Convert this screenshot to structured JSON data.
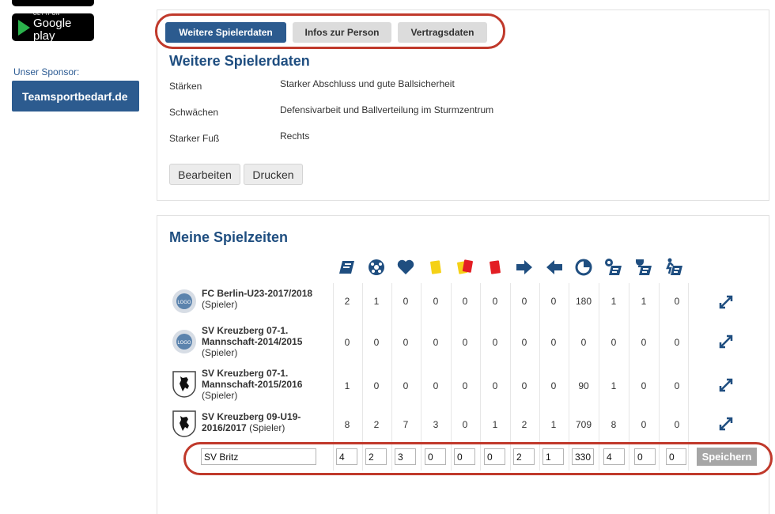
{
  "sidebar": {
    "badge_small": "GET IT ON",
    "badge_big": "Google play",
    "sponsor_label": "Unser Sponsor:",
    "sponsor_name": "Teamsportbedarf.de"
  },
  "tabs": [
    "Weitere Spielerdaten",
    "Infos zur Person",
    "Vertragsdaten"
  ],
  "details": {
    "title": "Weitere Spielerdaten",
    "rows": [
      {
        "label": "Stärken",
        "value": "Starker Abschluss und gute Ballsicherheit"
      },
      {
        "label": "Schwächen",
        "value": "Defensivarbeit und Ballverteilung im Sturmzentrum"
      },
      {
        "label": "Starker Fuß",
        "value": "Rechts"
      }
    ],
    "edit_label": "Bearbeiten",
    "print_label": "Drucken"
  },
  "playtimes": {
    "title": "Meine Spielzeiten",
    "columns": [
      "appearances-icon",
      "goals-icon",
      "assists-icon",
      "yellow-card-icon",
      "yellow-red-card-icon",
      "red-card-icon",
      "subbed-in-icon",
      "subbed-out-icon",
      "minutes-icon",
      "starting-eleven-icon",
      "captain-icon",
      "substitute-icon"
    ],
    "colors": {
      "icon": "#1f4e80",
      "yellow": "#f5d116",
      "red": "#e31e24",
      "panel_title": "#1f4e80",
      "highlight": "#c0392b"
    },
    "rows": [
      {
        "club": "FC Berlin-U23-2017/2018",
        "role": "(Spieler)",
        "logo": "generic-club-logo",
        "stats": [
          "2",
          "1",
          "0",
          "0",
          "0",
          "0",
          "0",
          "0",
          "180",
          "1",
          "1",
          "0"
        ]
      },
      {
        "club": "SV Kreuzberg 07-1. Mannschaft-2014/2015",
        "role": "(Spieler)",
        "logo": "generic-club-logo",
        "stats": [
          "0",
          "0",
          "0",
          "0",
          "0",
          "0",
          "0",
          "0",
          "0",
          "0",
          "0",
          "0"
        ]
      },
      {
        "club": "SV Kreuzberg 07-1. Mannschaft-2015/2016",
        "role": "(Spieler)",
        "logo": "berlin-bear-logo",
        "stats": [
          "1",
          "0",
          "0",
          "0",
          "0",
          "0",
          "0",
          "0",
          "90",
          "1",
          "0",
          "0"
        ]
      },
      {
        "club": "SV Kreuzberg 09-U19-2016/2017",
        "role": "(Spieler)",
        "logo": "berlin-bear-logo",
        "stats": [
          "8",
          "2",
          "7",
          "3",
          "0",
          "1",
          "2",
          "1",
          "709",
          "8",
          "0",
          "0"
        ]
      }
    ],
    "new_row": {
      "club": "SV Britz",
      "values": [
        "4",
        "2",
        "3",
        "0",
        "0",
        "0",
        "2",
        "1",
        "330",
        "4",
        "0",
        "0"
      ],
      "save_label": "Speichern"
    }
  }
}
